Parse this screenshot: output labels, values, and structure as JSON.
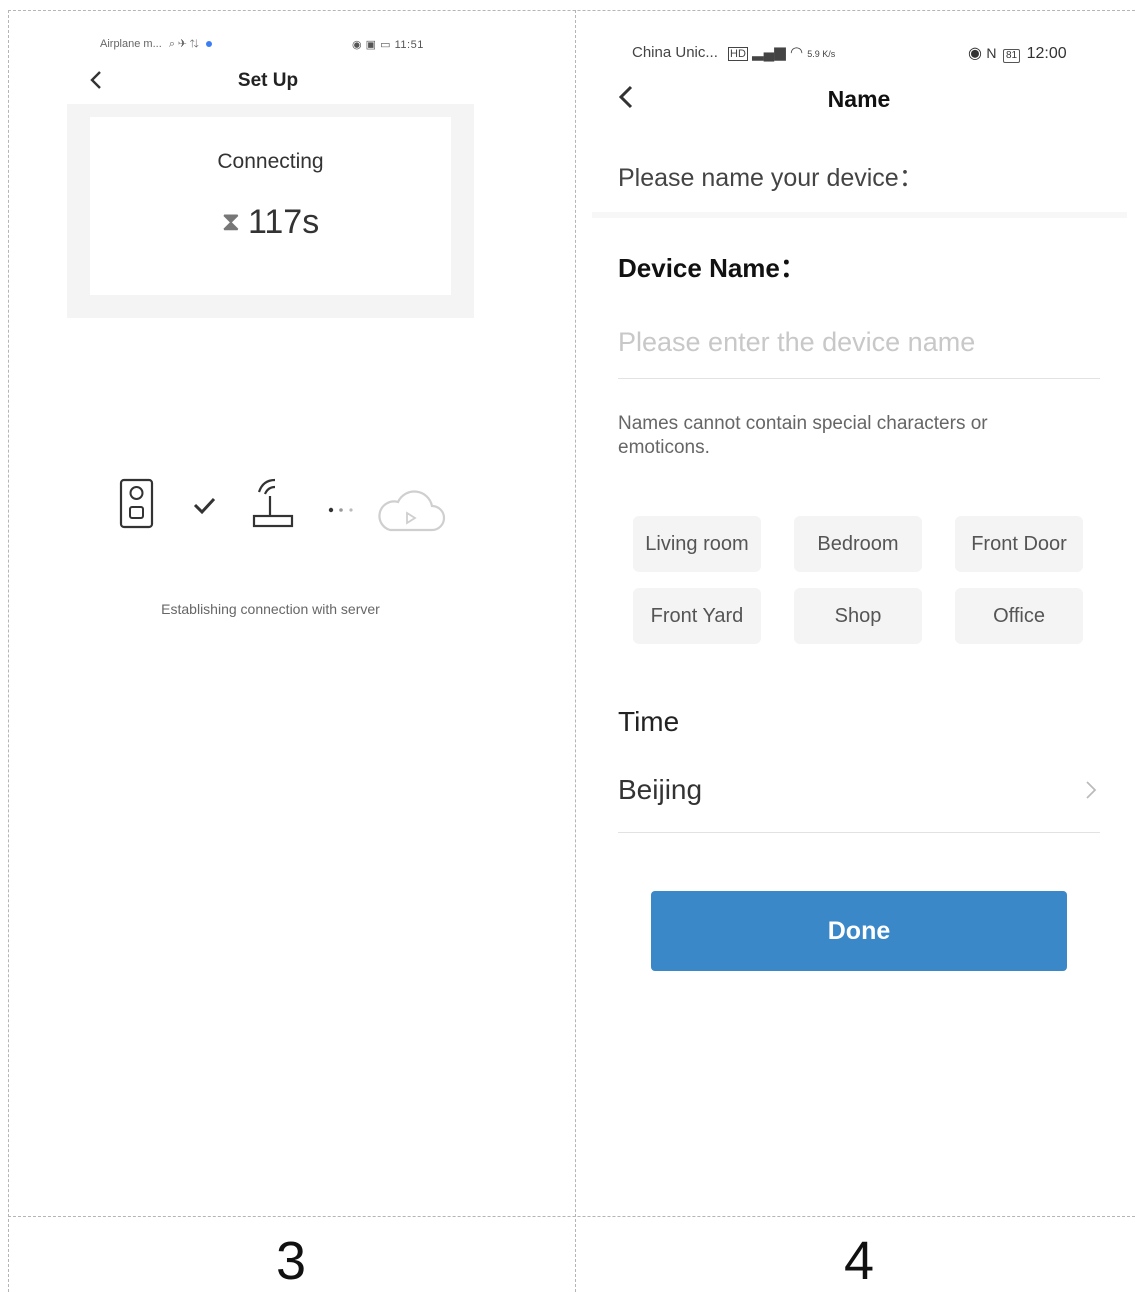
{
  "left_screen": {
    "status_bar": {
      "left_text": "Airplane m...",
      "right_text": "11:51"
    },
    "title": "Set Up",
    "card": {
      "status": "Connecting",
      "countdown": "117s"
    },
    "connection_icons": [
      "doorbell-icon",
      "check-icon",
      "router-icon",
      "ellipsis-icon",
      "cloud-icon"
    ],
    "message": "Establishing connection with server"
  },
  "right_screen": {
    "status_bar": {
      "carrier": "China Unic...",
      "speed_value": "5.9",
      "speed_unit": "K/s",
      "battery": "81",
      "time": "12:00"
    },
    "title": "Name",
    "prompt": "Please name your device：",
    "device_name_label": "Device Name：",
    "device_name_input": {
      "value": "",
      "placeholder": "Please enter the device name"
    },
    "hint": "Names cannot contain special characters or emoticons.",
    "suggestions": [
      "Living room",
      "Bedroom",
      "Front Door",
      "Front Yard",
      "Shop",
      "Office"
    ],
    "time_label": "Time",
    "timezone": "Beijing",
    "done_label": "Done",
    "accent_color": "#3a88c8"
  },
  "step_labels": [
    "3",
    "4"
  ]
}
